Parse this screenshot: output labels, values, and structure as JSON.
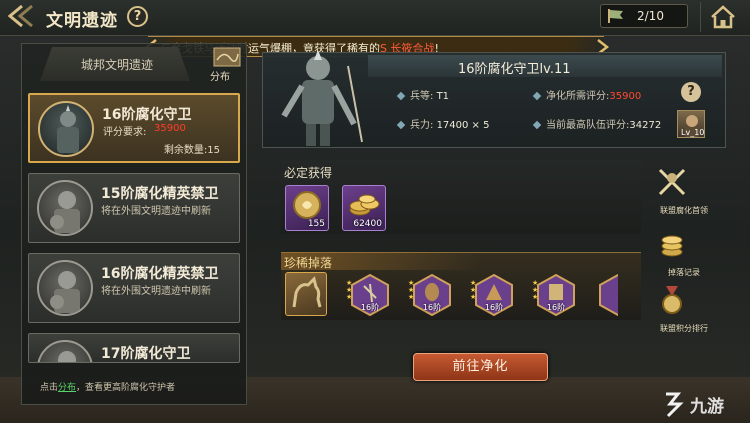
{
  "header": {
    "title": "文明遗迹",
    "help_icon": "?",
    "counter": "2/10"
  },
  "marquee": {
    "text_prefix": "与金戈铁马活动时运气爆棚，竟获得了稀有的",
    "text_highlight": "S 长筱合战",
    "text_suffix": "!"
  },
  "left": {
    "tab_label": "城邦文明遗迹",
    "dist_label": "分布",
    "cards": [
      {
        "title": "16阶腐化守卫",
        "req_label": "评分要求:",
        "req_value": "35900",
        "remain": "剩余数量:15"
      },
      {
        "title": "15阶腐化精英禁卫",
        "sub": "将在外围文明遗迹中刷新"
      },
      {
        "title": "16阶腐化精英禁卫",
        "sub": "将在外围文明遗迹中刷新"
      },
      {
        "title": "17阶腐化守卫"
      }
    ],
    "footer_prefix": "点击",
    "footer_link": "分布",
    "footer_suffix": "，查看更高阶腐化守护者"
  },
  "boss": {
    "name": "16阶腐化守卫lv.11",
    "rank_label": "兵等:",
    "rank_value": "T1",
    "purify_label": "净化所需评分:",
    "purify_value": "35900",
    "troops_label": "兵力:",
    "troops_value": "17400 × 5",
    "best_label": "当前最高队伍评分:",
    "best_value": "34272",
    "player_lv": "Lv_10"
  },
  "must_get": {
    "title": "必定获得",
    "items": [
      {
        "icon": "medal-icon",
        "qty": "155"
      },
      {
        "icon": "gold-coins-icon",
        "qty": "62400"
      }
    ]
  },
  "rare_drop": {
    "title": "珍稀掉落",
    "item_label": "16阶"
  },
  "side": [
    {
      "label": "联盟腐化首领"
    },
    {
      "label": "掉落记录"
    },
    {
      "label": "联盟积分排行"
    }
  ],
  "go_button": "前往净化",
  "watermark": "九游",
  "colors": {
    "accent_gold": "#d7a94c",
    "alert_red": "#ff3b2a",
    "link_green": "#59d36a",
    "button_orange": "#c65a32"
  }
}
